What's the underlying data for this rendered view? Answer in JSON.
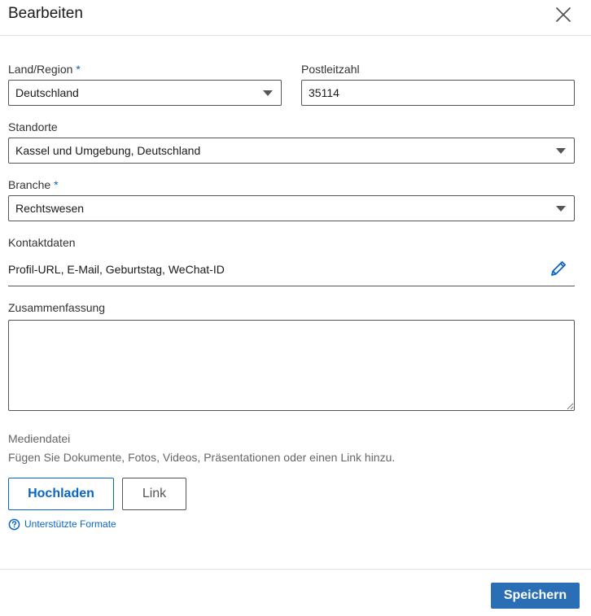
{
  "header": {
    "title": "Bearbeiten"
  },
  "form": {
    "country": {
      "label": "Land/Region",
      "required_mark": "*",
      "value": "Deutschland"
    },
    "postal": {
      "label": "Postleitzahl",
      "value": "35114"
    },
    "locations": {
      "label": "Standorte",
      "value": "Kassel und Umgebung, Deutschland"
    },
    "industry": {
      "label": "Branche",
      "required_mark": "*",
      "value": "Rechtswesen"
    },
    "contact": {
      "label": "Kontaktdaten",
      "value": "Profil-URL, E-Mail, Geburtstag, WeChat-ID"
    },
    "summary": {
      "label": "Zusammenfassung",
      "value": ""
    },
    "media": {
      "title": "Mediendatei",
      "description": "Fügen Sie Dokumente, Fotos, Videos, Präsentationen oder einen Link hinzu.",
      "upload_label": "Hochladen",
      "link_label": "Link",
      "formats_label": "Unterstützte Formate"
    }
  },
  "footer": {
    "save_label": "Speichern"
  },
  "colors": {
    "accent": "#0a66c2",
    "save_button": "#2a6fb5"
  },
  "icons": [
    "close-icon",
    "chevron-down-icon",
    "pencil-icon",
    "question-circle-icon"
  ]
}
